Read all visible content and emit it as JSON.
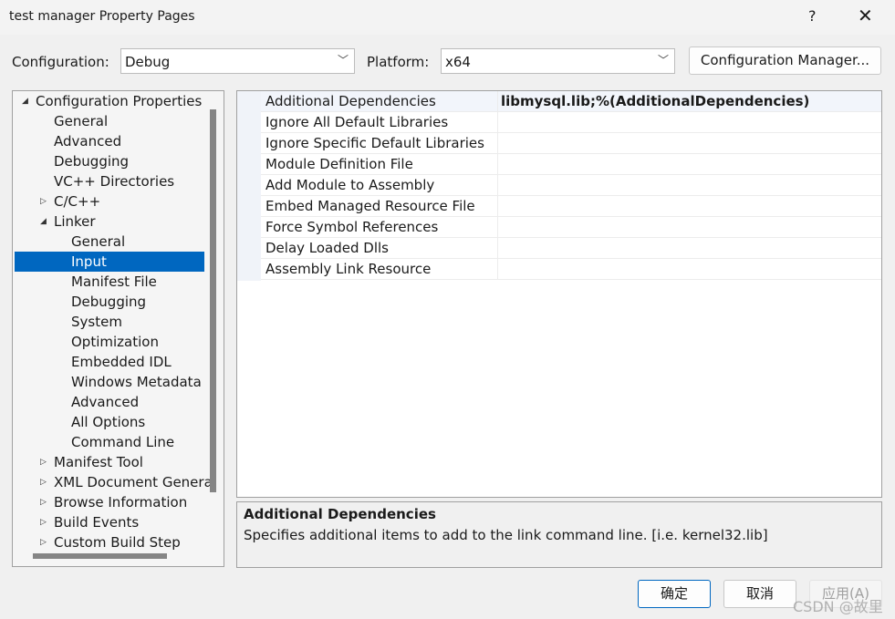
{
  "window": {
    "title": "test manager Property Pages",
    "help": "?",
    "close": "✕"
  },
  "toolbar": {
    "configuration_label": "Configuration:",
    "configuration_value": "Debug",
    "platform_label": "Platform:",
    "platform_value": "x64",
    "config_manager": "Configuration Manager..."
  },
  "tree": [
    {
      "label": "Configuration Properties",
      "level": 0,
      "state": "expanded"
    },
    {
      "label": "General",
      "level": 1
    },
    {
      "label": "Advanced",
      "level": 1
    },
    {
      "label": "Debugging",
      "level": 1
    },
    {
      "label": "VC++ Directories",
      "level": 1
    },
    {
      "label": "C/C++",
      "level": 1,
      "state": "collapsed"
    },
    {
      "label": "Linker",
      "level": 1,
      "state": "expanded"
    },
    {
      "label": "General",
      "level": 2
    },
    {
      "label": "Input",
      "level": 2,
      "selected": true
    },
    {
      "label": "Manifest File",
      "level": 2
    },
    {
      "label": "Debugging",
      "level": 2
    },
    {
      "label": "System",
      "level": 2
    },
    {
      "label": "Optimization",
      "level": 2
    },
    {
      "label": "Embedded IDL",
      "level": 2
    },
    {
      "label": "Windows Metadata",
      "level": 2
    },
    {
      "label": "Advanced",
      "level": 2
    },
    {
      "label": "All Options",
      "level": 2
    },
    {
      "label": "Command Line",
      "level": 2
    },
    {
      "label": "Manifest Tool",
      "level": 1,
      "state": "collapsed"
    },
    {
      "label": "XML Document Genera",
      "level": 1,
      "state": "collapsed"
    },
    {
      "label": "Browse Information",
      "level": 1,
      "state": "collapsed"
    },
    {
      "label": "Build Events",
      "level": 1,
      "state": "collapsed"
    },
    {
      "label": "Custom Build Step",
      "level": 1,
      "state": "collapsed"
    }
  ],
  "properties": [
    {
      "name": "Additional Dependencies",
      "value": "libmysql.lib;%(AdditionalDependencies)"
    },
    {
      "name": "Ignore All Default Libraries",
      "value": ""
    },
    {
      "name": "Ignore Specific Default Libraries",
      "value": ""
    },
    {
      "name": "Module Definition File",
      "value": ""
    },
    {
      "name": "Add Module to Assembly",
      "value": ""
    },
    {
      "name": "Embed Managed Resource File",
      "value": ""
    },
    {
      "name": "Force Symbol References",
      "value": ""
    },
    {
      "name": "Delay Loaded Dlls",
      "value": ""
    },
    {
      "name": "Assembly Link Resource",
      "value": ""
    }
  ],
  "description": {
    "title": "Additional Dependencies",
    "text": "Specifies additional items to add to the link command line. [i.e. kernel32.lib]"
  },
  "buttons": {
    "ok": "确定",
    "cancel": "取消",
    "apply": "应用(A)"
  },
  "watermark": "CSDN @故里"
}
